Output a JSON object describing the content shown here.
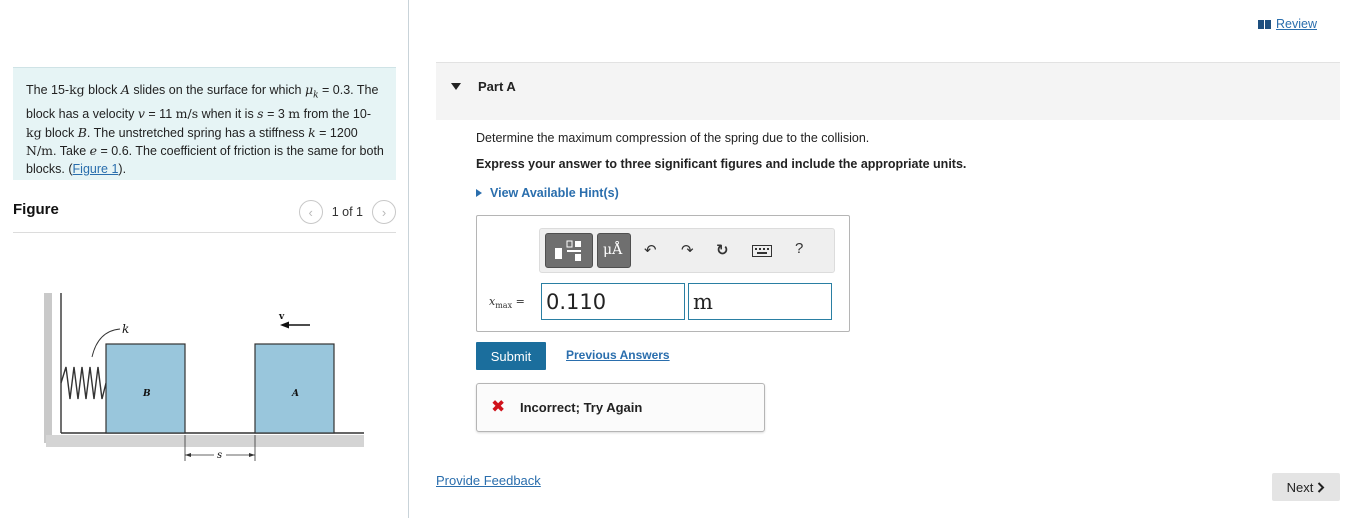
{
  "problem": {
    "t1": "The 15-",
    "kg1": "kg",
    "t2": " block ",
    "A": "A",
    "t3": " slides on the surface for which ",
    "mu": "μ",
    "mu_sub": "k",
    "t4": " = 0.3. The block has a velocity ",
    "v": "v",
    "t5": " = 11 ",
    "vunit": "m/s",
    "t6": " when it is ",
    "s": "s",
    "t7": " = 3 ",
    "m": "m",
    "t8": " from the 10-",
    "kg2": "kg",
    "t9": " block ",
    "B": "B",
    "t10": ". The unstretched spring has a stiffness ",
    "k": "k",
    "t11": " = 1200 ",
    "kunit": "N/m",
    "t12": ". Take ",
    "e": "e",
    "t13": " = 0.6. The coefficient of friction is the same for both blocks. (",
    "figure_link": "Figure 1",
    "t14": ")."
  },
  "figure_panel": {
    "title": "Figure",
    "pager": "1 of 1",
    "labels": {
      "k": "k",
      "v": "v",
      "B": "B",
      "A": "A",
      "s": "s"
    },
    "colors": {
      "block": "#99c6dc",
      "ground": "#999999"
    }
  },
  "header": {
    "review": "Review"
  },
  "part": {
    "title": "Part A",
    "question": "Determine the maximum compression of the spring due to the collision.",
    "instruction": "Express your answer to three significant figures and include the appropriate units.",
    "hints": "View Available Hint(s)"
  },
  "answer": {
    "label_var": "x",
    "label_sub": "max",
    "label_eq": " =",
    "value": "0.110",
    "unit": "m",
    "toolbar": {
      "mu_a": "μÅ",
      "help": "?"
    }
  },
  "actions": {
    "submit": "Submit",
    "previous": "Previous Answers"
  },
  "feedback": {
    "mark": "✖",
    "text": "Incorrect; Try Again"
  },
  "footer": {
    "provide_feedback": "Provide Feedback",
    "next": "Next"
  },
  "colors": {
    "accent": "#1b6e9d",
    "link": "#2a6ead",
    "error": "#d0121b",
    "problem_bg": "#e6f4f5"
  }
}
